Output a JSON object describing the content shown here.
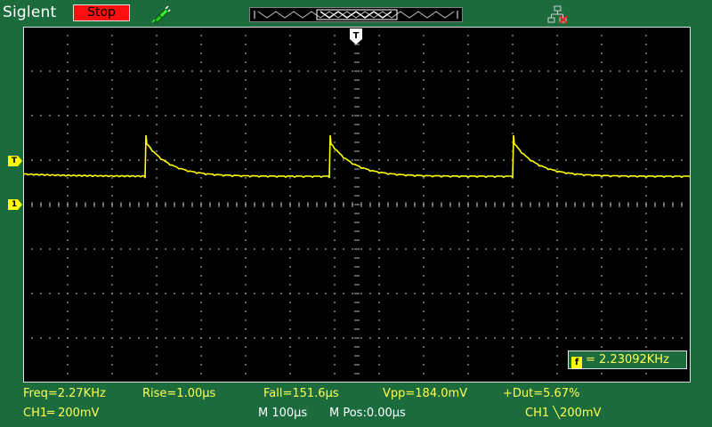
{
  "header": {
    "brand": "Siglent",
    "run_state": "Stop",
    "trigger_position_marker": "T"
  },
  "colors": {
    "background": "#1b6b3c",
    "screen": "#000000",
    "channel1": "#ffff00",
    "run_state": "#ff1010"
  },
  "icons": [
    "probe-icon",
    "network-disconnected-icon"
  ],
  "markers": {
    "trigger_level": "T",
    "channel1_ground": "1"
  },
  "counter": {
    "label": "= 2.23092KHz"
  },
  "measurements": {
    "freq": "Freq=2.27KHz",
    "rise": "Rise=1.00µs",
    "fall": "Fall=151.6µs",
    "vpp": "Vpp=184.0mV",
    "duty": "+Dut=5.67%"
  },
  "status": {
    "ch1_scale": "CH1═ 200mV",
    "timebase": "M 100µs",
    "position": "M Pos:0.00µs",
    "trigger": "CH1 ╲200mV"
  }
}
